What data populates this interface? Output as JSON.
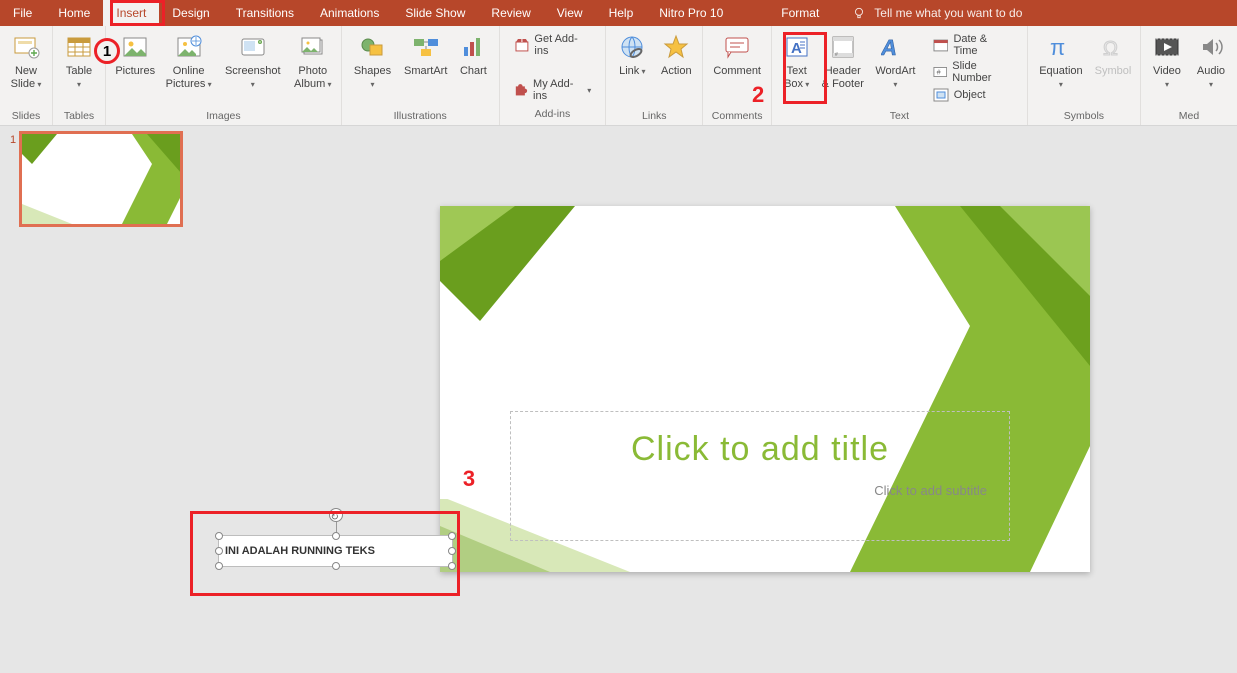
{
  "menu": {
    "tabs": [
      "File",
      "Home",
      "Insert",
      "Design",
      "Transitions",
      "Animations",
      "Slide Show",
      "Review",
      "View",
      "Help",
      "Nitro Pro 10"
    ],
    "active": "Insert",
    "format": "Format",
    "tellme": "Tell me what you want to do"
  },
  "ribbon": {
    "groups": {
      "slides": {
        "label": "Slides",
        "new_slide": "New\nSlide"
      },
      "tables": {
        "label": "Tables",
        "table": "Table"
      },
      "images": {
        "label": "Images",
        "pictures": "Pictures",
        "online_pictures": "Online\nPictures",
        "screenshot": "Screenshot",
        "photo_album": "Photo\nAlbum"
      },
      "illustrations": {
        "label": "Illustrations",
        "shapes": "Shapes",
        "smartart": "SmartArt",
        "chart": "Chart"
      },
      "addins": {
        "label": "Add-ins",
        "get": "Get Add-ins",
        "my": "My Add-ins"
      },
      "links": {
        "label": "Links",
        "link": "Link",
        "action": "Action"
      },
      "comments": {
        "label": "Comments",
        "comment": "Comment"
      },
      "text": {
        "label": "Text",
        "text_box": "Text\nBox",
        "header_footer": "Header\n& Footer",
        "wordart": "WordArt",
        "date_time": "Date & Time",
        "slide_number": "Slide Number",
        "object": "Object"
      },
      "symbols": {
        "label": "Symbols",
        "equation": "Equation",
        "symbol": "Symbol"
      },
      "media": {
        "label": "Med",
        "video": "Video",
        "audio": "Audio"
      }
    }
  },
  "slide": {
    "title_placeholder": "Click to add title",
    "subtitle_placeholder": "Click to add subtitle",
    "textbox_content": "INI ADALAH RUNNING TEKS"
  },
  "thumb": {
    "number": "1"
  },
  "annotations": {
    "n1": "1",
    "n2": "2",
    "n3": "3"
  }
}
